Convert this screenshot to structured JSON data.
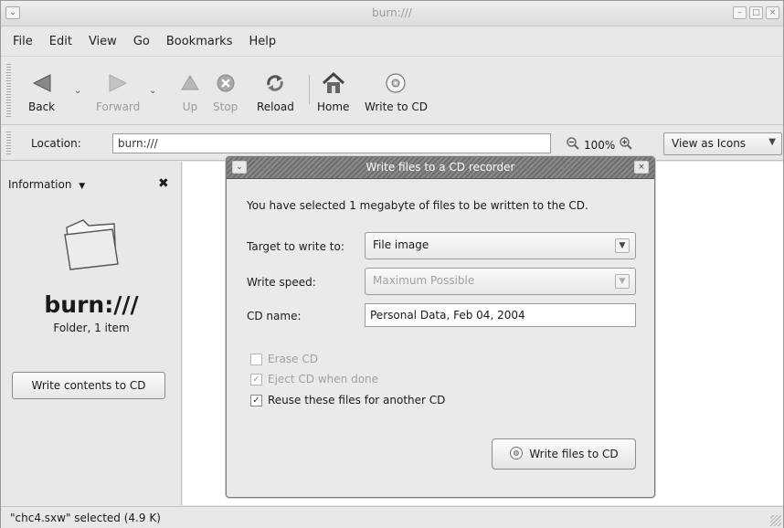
{
  "window": {
    "title": "burn:///"
  },
  "menubar": {
    "items": [
      {
        "label": "File"
      },
      {
        "label": "Edit"
      },
      {
        "label": "View"
      },
      {
        "label": "Go"
      },
      {
        "label": "Bookmarks"
      },
      {
        "label": "Help"
      }
    ]
  },
  "toolbar": {
    "back": "Back",
    "forward": "Forward",
    "up": "Up",
    "stop": "Stop",
    "reload": "Reload",
    "home": "Home",
    "write_to_cd": "Write to CD"
  },
  "location": {
    "label": "Location:",
    "value": "burn:///",
    "zoom": "100%",
    "view_mode": "View as Icons"
  },
  "sidepane": {
    "header": "Information",
    "folder_name": "burn:///",
    "folder_info": "Folder, 1 item",
    "write_button": "Write contents to CD"
  },
  "status": {
    "text": "\"chc4.sxw\" selected (4.9 K)"
  },
  "dialog": {
    "title": "Write files to a CD recorder",
    "message": "You have selected 1 megabyte of files to be written to the CD.",
    "target_label": "Target to write to:",
    "target_value": "File image",
    "speed_label": "Write speed:",
    "speed_value": "Maximum Possible",
    "cdname_label": "CD name:",
    "cdname_value": "Personal Data, Feb 04, 2004",
    "erase_cd": "Erase CD",
    "eject_cd": "Eject CD when done",
    "reuse_files": "Reuse these files for another CD",
    "write_button": "Write files to CD"
  }
}
